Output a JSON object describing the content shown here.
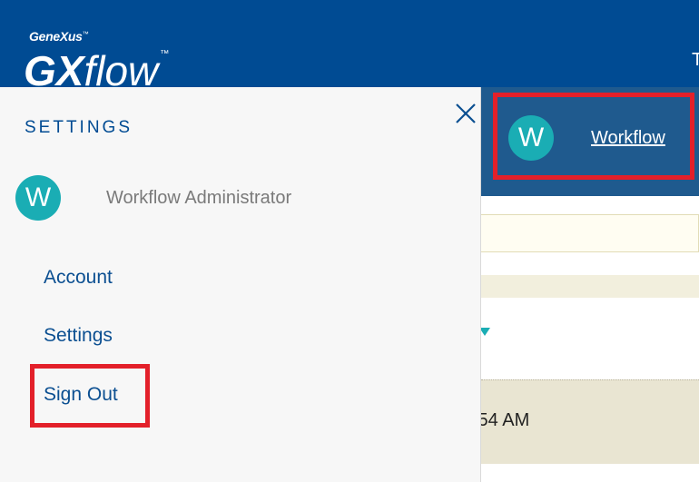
{
  "header": {
    "brand_small": "GeneXus",
    "brand_small_tm": "™",
    "brand_gx": "GX",
    "brand_flow": "flow",
    "brand_tm": "™",
    "edge_char": "T"
  },
  "user_menu": {
    "avatar_initial": "W",
    "link_label": "Workflow"
  },
  "settings_panel": {
    "title": "SETTINGS",
    "close_icon": "close-icon",
    "profile": {
      "avatar_initial": "W",
      "name": "Workflow Administrator"
    },
    "links": {
      "account": "Account",
      "settings": "Settings",
      "sign_out": "Sign Out"
    }
  },
  "background": {
    "row_time": ":54 AM"
  },
  "colors": {
    "header_bg": "#004b93",
    "avatar": "#1aadb4",
    "highlight": "#e3202a",
    "link": "#0b4f91"
  }
}
